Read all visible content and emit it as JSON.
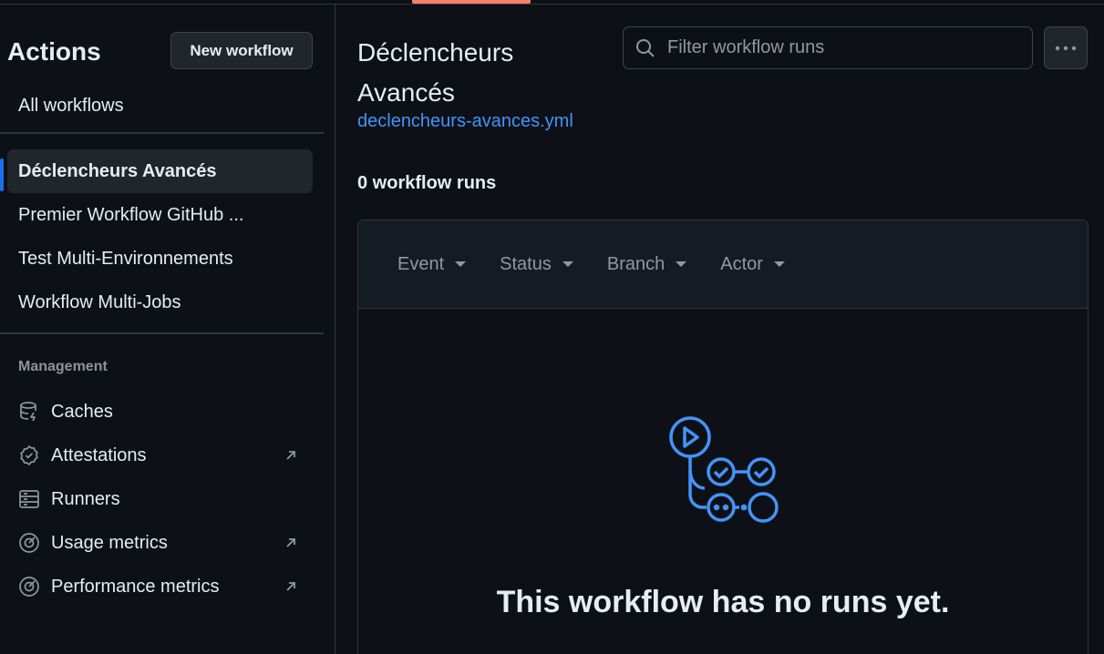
{
  "sidebar": {
    "title": "Actions",
    "new_workflow_label": "New workflow",
    "all_workflows_label": "All workflows",
    "workflows": [
      {
        "label": "Déclencheurs Avancés",
        "active": true
      },
      {
        "label": "Premier Workflow GitHub ...",
        "active": false
      },
      {
        "label": "Test Multi-Environnements",
        "active": false
      },
      {
        "label": "Workflow Multi-Jobs",
        "active": false
      }
    ],
    "management_label": "Management",
    "management_items": [
      {
        "label": "Caches",
        "icon": "database-icon",
        "external": false
      },
      {
        "label": "Attestations",
        "icon": "verified-icon",
        "external": true
      },
      {
        "label": "Runners",
        "icon": "server-icon",
        "external": false
      },
      {
        "label": "Usage metrics",
        "icon": "meter-icon",
        "external": true
      },
      {
        "label": "Performance metrics",
        "icon": "meter-icon",
        "external": true
      }
    ]
  },
  "main": {
    "title": "Déclencheurs Avancés",
    "workflow_file": "declencheurs-avances.yml",
    "search_placeholder": "Filter workflow runs",
    "runs_count": "0 workflow runs",
    "filters": [
      "Event",
      "Status",
      "Branch",
      "Actor"
    ],
    "empty_message": "This workflow has no runs yet."
  },
  "colors": {
    "background": "#0d1117",
    "accent_link": "#4493f8",
    "active_indicator": "#1f6feb",
    "tab_underline": "#f78166",
    "illustration": "#4493f8"
  }
}
